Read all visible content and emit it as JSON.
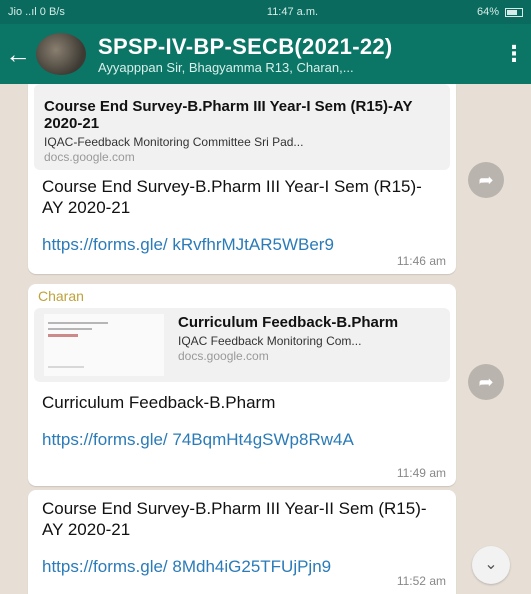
{
  "status_bar": {
    "left": "Jio ..ıl 0 B/s",
    "time": "11:47 a.m.",
    "battery": "64%"
  },
  "header": {
    "back_icon": "arrow-left",
    "title": "SPSP-IV-BP-SECB(2021-22)",
    "members": "Ayyapppan Sir, Bhagyamma R13, Charan,...",
    "menu_icon": "more-vertical"
  },
  "messages": [
    {
      "preview_title": "Course End Survey-B.Pharm III Year-I Sem (R15)-AY 2020-21",
      "preview_desc": "IQAC-Feedback Monitoring Committee Sri Pad...",
      "preview_domain": "docs.google.com",
      "text": "Course End Survey-B.Pharm III Year-I Sem (R15)-AY 2020-21",
      "link": "https://forms.gle/ kRvfhrMJtAR5WBer9",
      "time": "11:46 am"
    },
    {
      "sender": "Charan",
      "preview_title": "Curriculum Feedback-B.Pharm",
      "preview_desc": "IQAC Feedback Monitoring Com...",
      "preview_domain": "docs.google.com",
      "text": "Curriculum Feedback-B.Pharm",
      "link": "https://forms.gle/ 74BqmHt4gSWp8Rw4A",
      "time": "11:49 am"
    },
    {
      "text": "Course End Survey-B.Pharm III Year-II Sem (R15)-AY 2020-21",
      "link": "https://forms.gle/ 8Mdh4iG25TFUjPjn9",
      "time": "11:52 am"
    }
  ]
}
